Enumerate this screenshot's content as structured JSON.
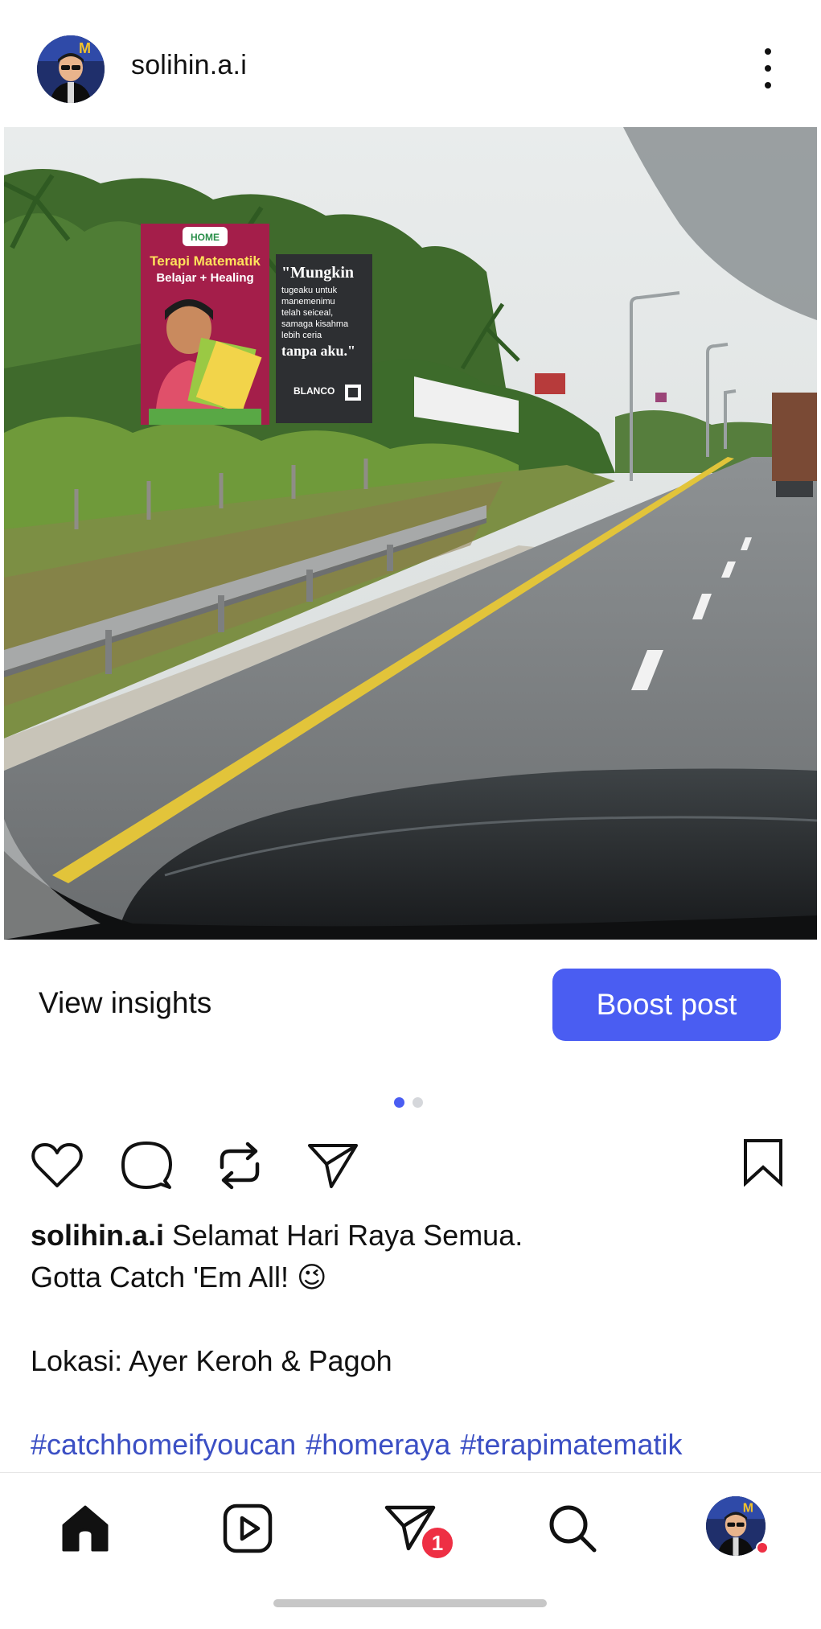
{
  "post": {
    "username": "solihin.a.i",
    "photo": {
      "billboard_left_title": "Terapi Matematik",
      "billboard_left_subtitle": "Belajar + Healing",
      "billboard_left_logo": "HOME",
      "billboard_right_line1": "\"Mungkin",
      "billboard_right_line2": "tugeaku untuk",
      "billboard_right_line3": "manemenimu",
      "billboard_right_line4": "telah seiceal,",
      "billboard_right_line5": "samaga kisahma",
      "billboard_right_line6": "lebih ceria",
      "billboard_right_line7": "tanpa aku.\"",
      "billboard_right_brand": "BLANCO"
    },
    "insights_label": "View insights",
    "boost_label": "Boost post",
    "caption": {
      "user": "solihin.a.i",
      "line1": "Selamat Hari Raya Semua.",
      "line2": "Gotta Catch 'Em All! 😉",
      "line3": "Lokasi: Ayer Keroh & Pagoh",
      "hashtags": [
        "#catchhomeifyoucan",
        "#homeraya",
        "#terapimatematik"
      ]
    }
  },
  "carousel": {
    "count": 2,
    "active_index": 0
  },
  "nav": {
    "messages_badge": "1"
  },
  "colors": {
    "accent": "#4a5df2",
    "badge": "#ee2f44",
    "hashtag": "#3b4fc4"
  },
  "icons": {
    "header": [
      "avatar",
      "more-vertical-icon"
    ],
    "actions": [
      "heart-icon",
      "comment-icon",
      "repost-icon",
      "share-icon",
      "bookmark-icon"
    ],
    "nav": [
      "home-icon",
      "reels-icon",
      "messages-icon",
      "search-icon",
      "profile-avatar"
    ]
  }
}
